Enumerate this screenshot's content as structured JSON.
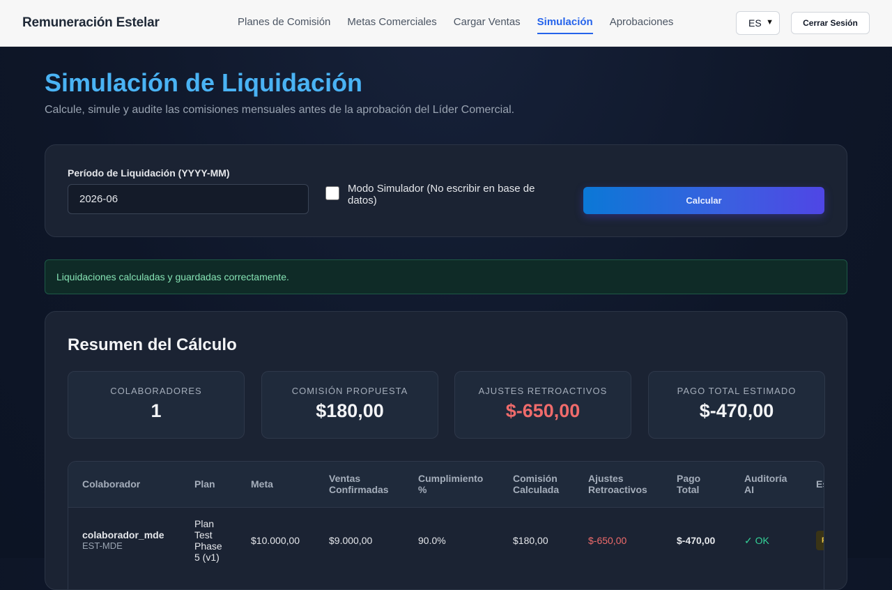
{
  "header": {
    "brand": "Remuneración Estelar",
    "nav": [
      {
        "label": "Planes de Comisión",
        "active": false
      },
      {
        "label": "Metas Comerciales",
        "active": false
      },
      {
        "label": "Cargar Ventas",
        "active": false
      },
      {
        "label": "Simulación",
        "active": true
      },
      {
        "label": "Aprobaciones",
        "active": false
      }
    ],
    "language": "ES",
    "logout_label": "Cerrar Sesión"
  },
  "page": {
    "title": "Simulación de Liquidación",
    "subtitle": "Calcule, simule y audite las comisiones mensuales antes de la aprobación del Líder Comercial."
  },
  "form": {
    "period_label": "Período de Liquidación (YYYY-MM)",
    "period_value": "2026-06",
    "simulator_label": "Modo Simulador (No escribir en base de datos)",
    "simulator_checked": false,
    "calculate_label": "Calcular"
  },
  "alert": {
    "message": "Liquidaciones calculadas y guardadas correctamente."
  },
  "summary": {
    "title": "Resumen del Cálculo",
    "stats": [
      {
        "label": "Colaboradores",
        "value": "1"
      },
      {
        "label": "Comisión Propuesta",
        "value": "$180,00"
      },
      {
        "label": "Ajustes Retroactivos",
        "value": "$-650,00"
      },
      {
        "label": "Pago Total Estimado",
        "value": "$-470,00"
      }
    ],
    "table": {
      "columns": [
        "Colaborador",
        "Plan",
        "Meta",
        "Ventas Confirmadas",
        "Cumplimiento %",
        "Comisión Calculada",
        "Ajustes Retroactivos",
        "Pago Total",
        "Auditoría AI",
        "Estado"
      ],
      "rows": [
        {
          "user": "colaborador_mde",
          "code": "EST-MDE",
          "plan": "Plan Test Phase 5 (v1)",
          "goal": "$10.000,00",
          "sales": "$9.000,00",
          "compliance": "90.0%",
          "commission": "$180,00",
          "adjustments": "$-650,00",
          "total": "$-470,00",
          "audit": "✓ OK",
          "status": "P"
        }
      ]
    }
  },
  "colors": {
    "accent": "#2563eb",
    "title": "#4ab3f4",
    "negative": "#ef6b6b",
    "ok": "#34d399",
    "badge": "#e8c547"
  }
}
